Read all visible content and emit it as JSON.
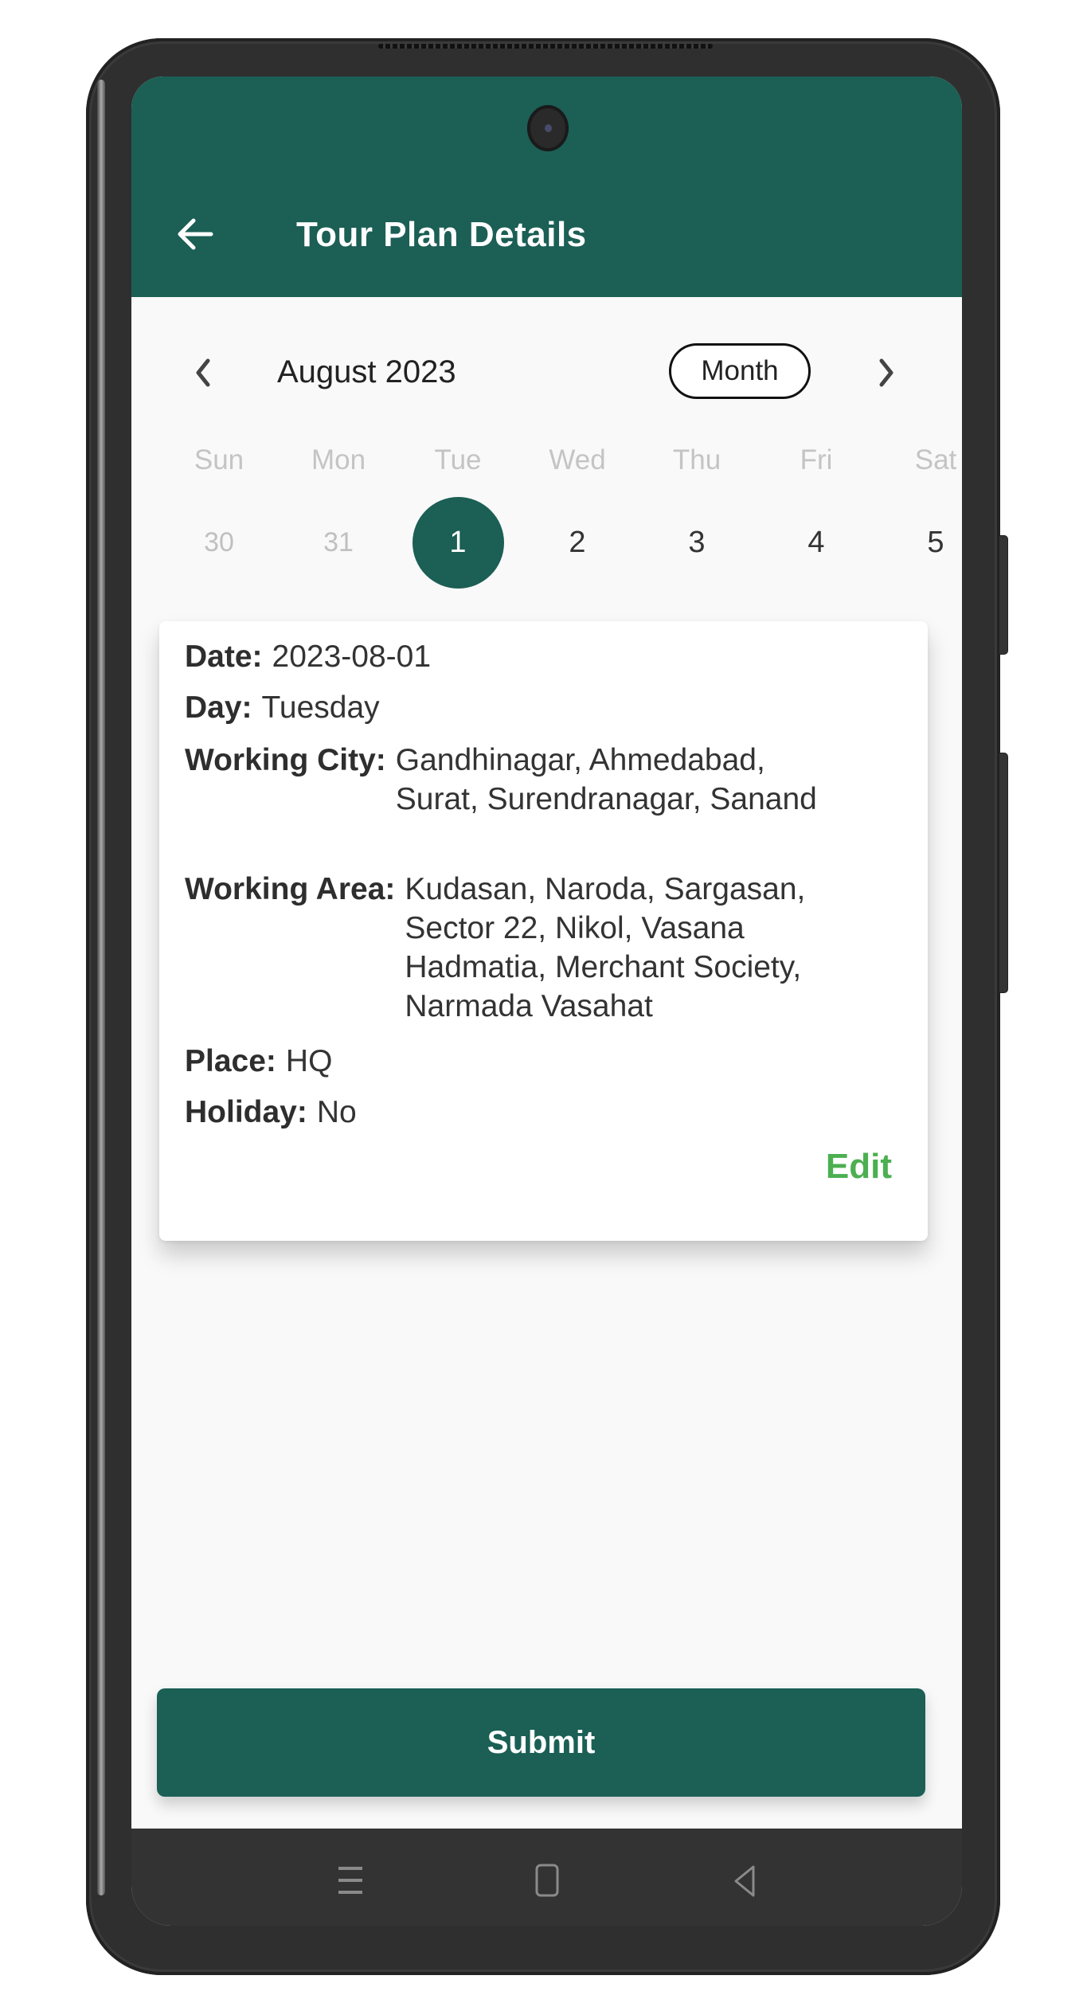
{
  "header": {
    "title": "Tour Plan Details",
    "back_icon": "arrow-left-icon"
  },
  "calendar": {
    "month_label": "August 2023",
    "view_mode": "Month",
    "prev_icon": "chevron-left-icon",
    "next_icon": "chevron-right-icon",
    "weekdays": [
      "Sun",
      "Mon",
      "Tue",
      "Wed",
      "Thu",
      "Fri",
      "Sat"
    ],
    "dates": [
      {
        "label": "30",
        "muted": true,
        "selected": false
      },
      {
        "label": "31",
        "muted": true,
        "selected": false
      },
      {
        "label": "1",
        "muted": false,
        "selected": true
      },
      {
        "label": "2",
        "muted": false,
        "selected": false
      },
      {
        "label": "3",
        "muted": false,
        "selected": false
      },
      {
        "label": "4",
        "muted": false,
        "selected": false
      },
      {
        "label": "5",
        "muted": false,
        "selected": false
      }
    ]
  },
  "details": {
    "date": {
      "label": "Date:",
      "value": "2023-08-01"
    },
    "day": {
      "label": "Day:",
      "value": "Tuesday"
    },
    "working_city": {
      "label": "Working City:",
      "value": "Gandhinagar, Ahmedabad, Surat, Surendranagar, Sanand"
    },
    "working_area": {
      "label": "Working Area:",
      "value": "Kudasan, Naroda, Sargasan, Sector 22, Nikol, Vasana Hadmatia, Merchant Society, Narmada Vasahat"
    },
    "place": {
      "label": "Place:",
      "value": "HQ"
    },
    "holiday": {
      "label": "Holiday:",
      "value": "No"
    },
    "edit_label": "Edit"
  },
  "actions": {
    "submit_label": "Submit"
  },
  "system_nav": {
    "icons": [
      "recent-apps-icon",
      "home-icon",
      "back-icon"
    ]
  },
  "colors": {
    "primary": "#1b5f55",
    "edit_link": "#4caf50",
    "muted_text": "#c0c0c0"
  }
}
